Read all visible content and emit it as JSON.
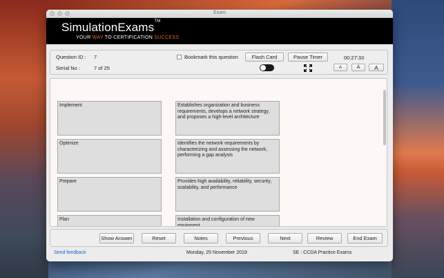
{
  "window": {
    "title": "Exam"
  },
  "banner": {
    "logo": "SimulationExams",
    "trademark": "TM",
    "tagline_prefix": "YOUR",
    "tagline_word1": "WAY",
    "tagline_mid": "TO CERTIFICATION",
    "tagline_word2": "SUCCESS",
    "accent_color": "#e4671e"
  },
  "info": {
    "question_id_label": "Question ID :",
    "question_id_value": "7",
    "serial_label": "Serial No :",
    "serial_value": "7 of 25",
    "bookmark_label": "Bookmark this question",
    "bookmark_checked": false,
    "flash_card_label": "Flash Card",
    "pause_timer_label": "Pause Timer",
    "timer": "00:27:33",
    "font_small": "A",
    "font_medium": "A",
    "font_large": "A",
    "toggle_on": true
  },
  "question": {
    "left_items": [
      "Implement",
      "Optimize",
      "Prepare",
      "Plan"
    ],
    "right_items": [
      "Establishes organization and business requirements, develops a network strategy, and proposes a high-level architecture",
      "Identifies the network requirements by characterizing and assessing the network, performing a gap analysis",
      "Provides high availability, reliability, security, scalability, and performance",
      "Installation and configuration of new equipment"
    ]
  },
  "nav": {
    "show_answer": "Show Answer",
    "reset": "Reset",
    "notes": "Notes",
    "previous": "Previous",
    "next": "Next",
    "review": "Review",
    "end_exam": "End Exam"
  },
  "footer": {
    "feedback": "Send feedback",
    "date": "Monday, 25 November 2019",
    "exam_name": "SE : CCDA Practice Exams"
  }
}
